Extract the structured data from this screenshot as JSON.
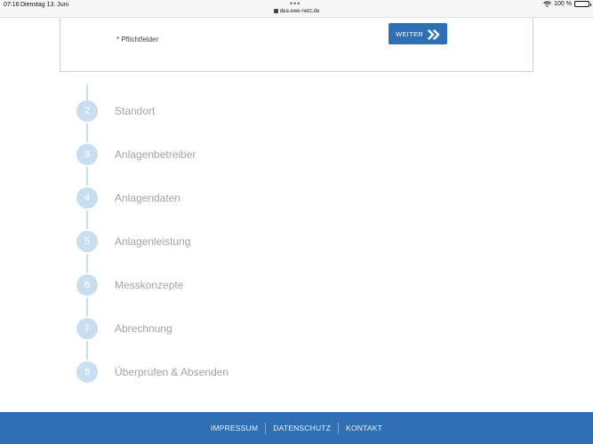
{
  "status_bar": {
    "time": "07:16",
    "date": "Dienstag 13. Juni",
    "url": "dea.ewe-netz.de",
    "battery": "100 %",
    "battery_level": 1.0
  },
  "form": {
    "required_note": "* Pflichtfelder",
    "next_button_label": "WEITER"
  },
  "steps": [
    {
      "number": "2",
      "label": "Standort"
    },
    {
      "number": "3",
      "label": "Anlagenbetreiber"
    },
    {
      "number": "4",
      "label": "Anlagendaten"
    },
    {
      "number": "5",
      "label": "Anlagenleistung"
    },
    {
      "number": "6",
      "label": "Messkonzepte"
    },
    {
      "number": "7",
      "label": "Abrechnung"
    },
    {
      "number": "8",
      "label": "Überprüfen & Absenden"
    }
  ],
  "footer": {
    "links": [
      "IMPRESSUM",
      "DATENSCHUTZ",
      "KONTAKT"
    ]
  },
  "colors": {
    "brand_blue": "#2f6fb4",
    "step_inactive": "#c9def0",
    "step_text": "#a3a3a3"
  }
}
